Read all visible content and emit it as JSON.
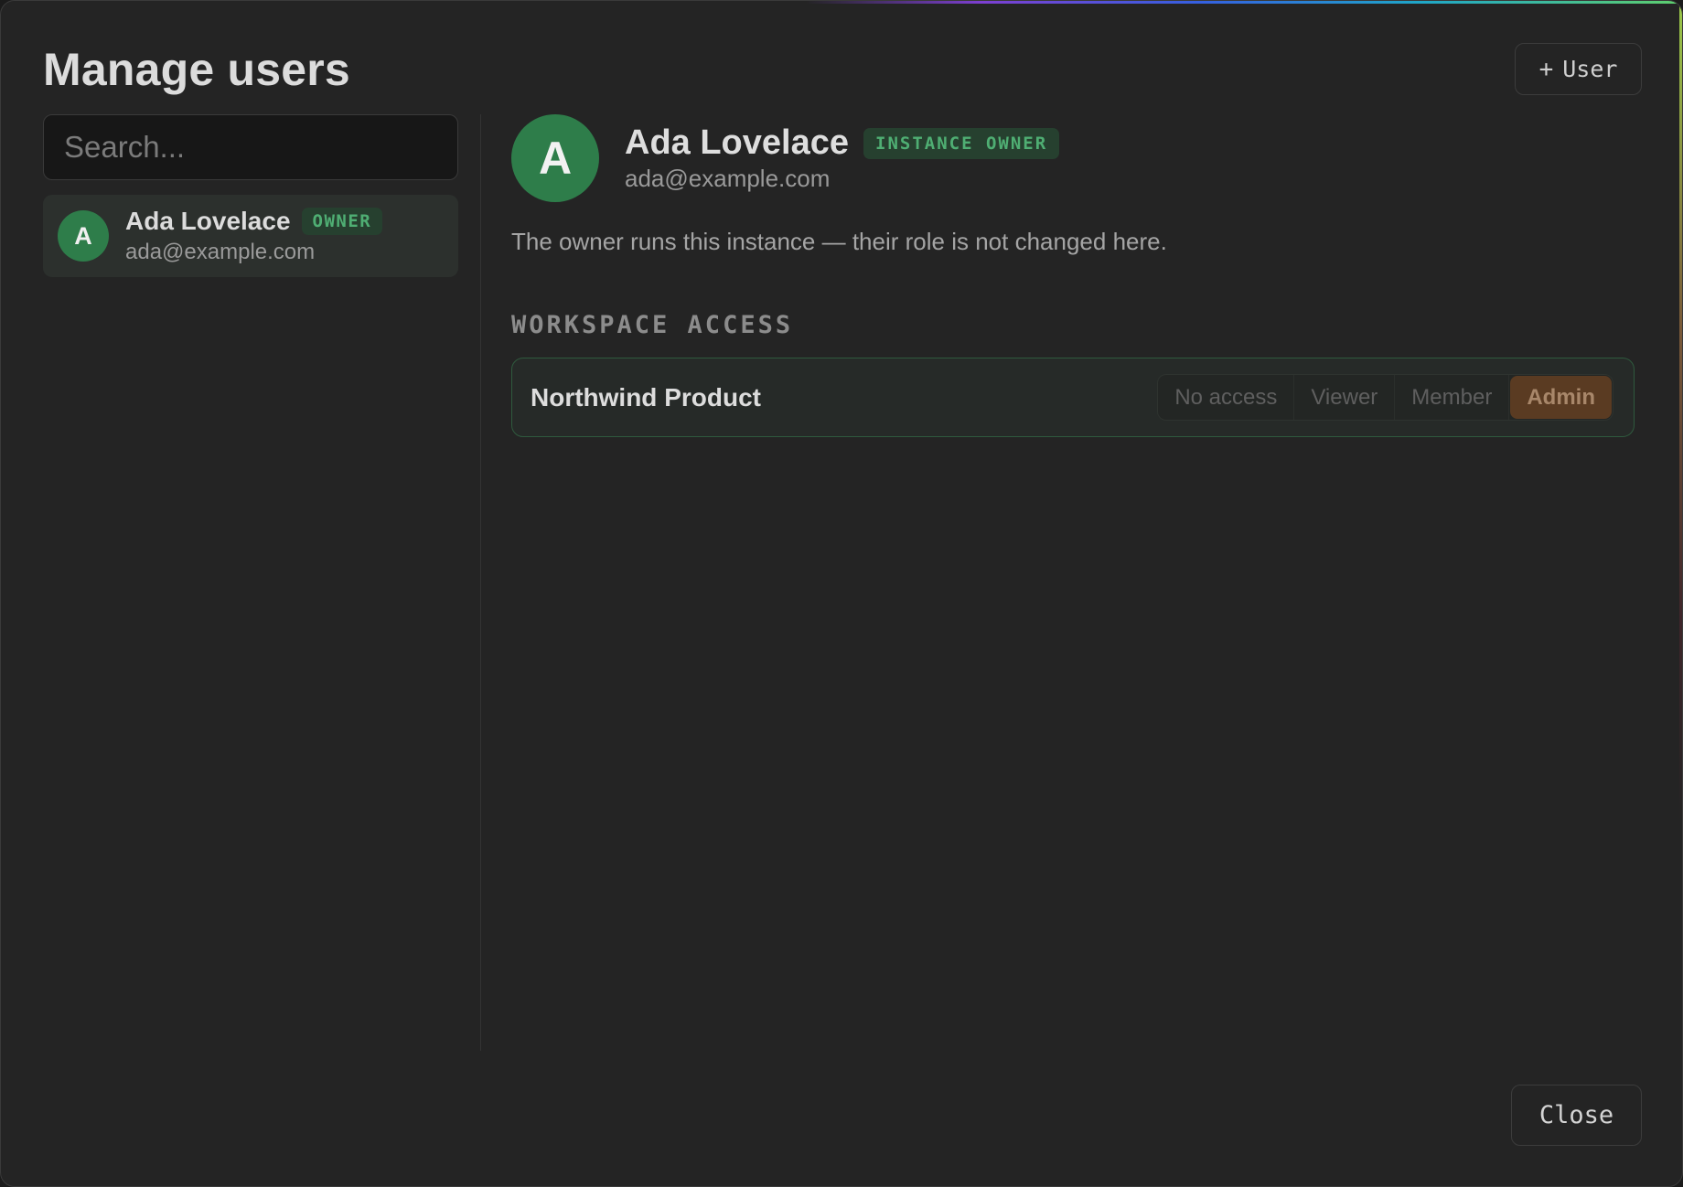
{
  "dialog": {
    "title": "Manage users",
    "add_user_label": "User",
    "close_label": "Close"
  },
  "sidebar": {
    "search_placeholder": "Search...",
    "users": [
      {
        "initial": "A",
        "name": "Ada Lovelace",
        "badge": "OWNER",
        "email": "ada@example.com"
      }
    ]
  },
  "detail": {
    "initial": "A",
    "name": "Ada Lovelace",
    "badge": "INSTANCE OWNER",
    "email": "ada@example.com",
    "note": "The owner runs this instance — their role is not changed here.",
    "workspace_section_title": "WORKSPACE ACCESS",
    "workspaces": [
      {
        "name": "Northwind Product",
        "roles": [
          "No access",
          "Viewer",
          "Member",
          "Admin"
        ],
        "selected_role": "Admin"
      }
    ]
  },
  "icons": {
    "add": "plus-icon"
  },
  "colors": {
    "avatar": "#2e7d4a",
    "badge_text": "#4fae73",
    "admin_selected": "#5a3b22",
    "workspace_border": "#2f5a3e"
  }
}
